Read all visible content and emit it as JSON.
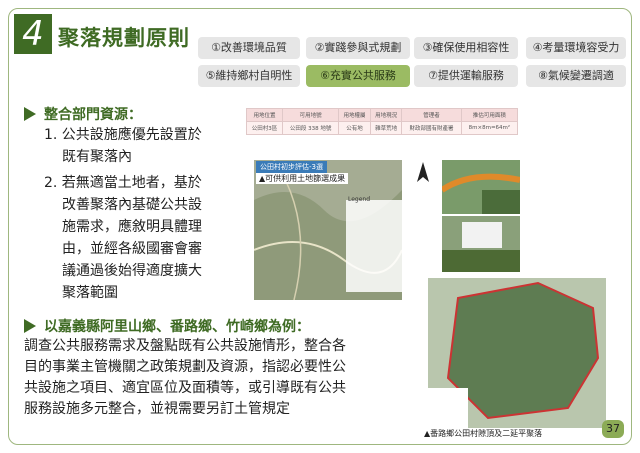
{
  "section": {
    "number": "4",
    "title": "聚落規劃原則"
  },
  "tabs": [
    {
      "label": "①改善環境品質",
      "active": false
    },
    {
      "label": "②實踐參與式規劃",
      "active": false
    },
    {
      "label": "③確保使用相容性",
      "active": false
    },
    {
      "label": "④考量環境容受力",
      "active": false
    },
    {
      "label": "⑤維持鄉村自明性",
      "active": false
    },
    {
      "label": "⑥充實公共服務",
      "active": true
    },
    {
      "label": "⑦提供運輸服務",
      "active": false
    },
    {
      "label": "⑧氣候變遷調適",
      "active": false
    }
  ],
  "point1": {
    "heading": "整合部門資源：",
    "items": [
      [
        "1. 公共設施應優先設置於",
        "既有聚落內"
      ],
      [
        "2. 若無適當土地者，基於",
        "改善聚落內基礎公共設",
        "施需求，應敘明具體理",
        "由，並經各級國審會審",
        "議通過後始得適度擴大",
        "聚落範圍"
      ]
    ]
  },
  "point2": {
    "heading": "以嘉義縣阿里山鄉、番路鄉、竹崎鄉為例：",
    "lines": [
      "調查公共服務需求及盤點既有公共設施情形，整合各",
      "目的事業主管機關之政策規劃及資源，指認必要性公",
      "共設施之項目、適宜區位及面積等，或引導既有公共",
      "服務設施多元整合，並視需要另訂土管規定"
    ]
  },
  "table": {
    "headers": [
      "用地位置",
      "可用地號",
      "用地權屬",
      "用地現況",
      "管理者",
      "推估可用面積"
    ],
    "row": [
      "公田村3區",
      "公田段 338 地號",
      "公有地",
      "雜草荒地",
      "財政部國有財產署",
      "8m×8m=64m²"
    ]
  },
  "map1": {
    "tag": "公田村初步評估-3選",
    "caption": "▲可供利用土地篩選成果",
    "legend_title": "Legend"
  },
  "map2": {
    "caption": "▲番路鄉公田村隙頂及二延平聚落"
  },
  "page_number": "37",
  "colors": {
    "brand_green": "#3f6b24",
    "active_tab": "#9bbb63"
  }
}
